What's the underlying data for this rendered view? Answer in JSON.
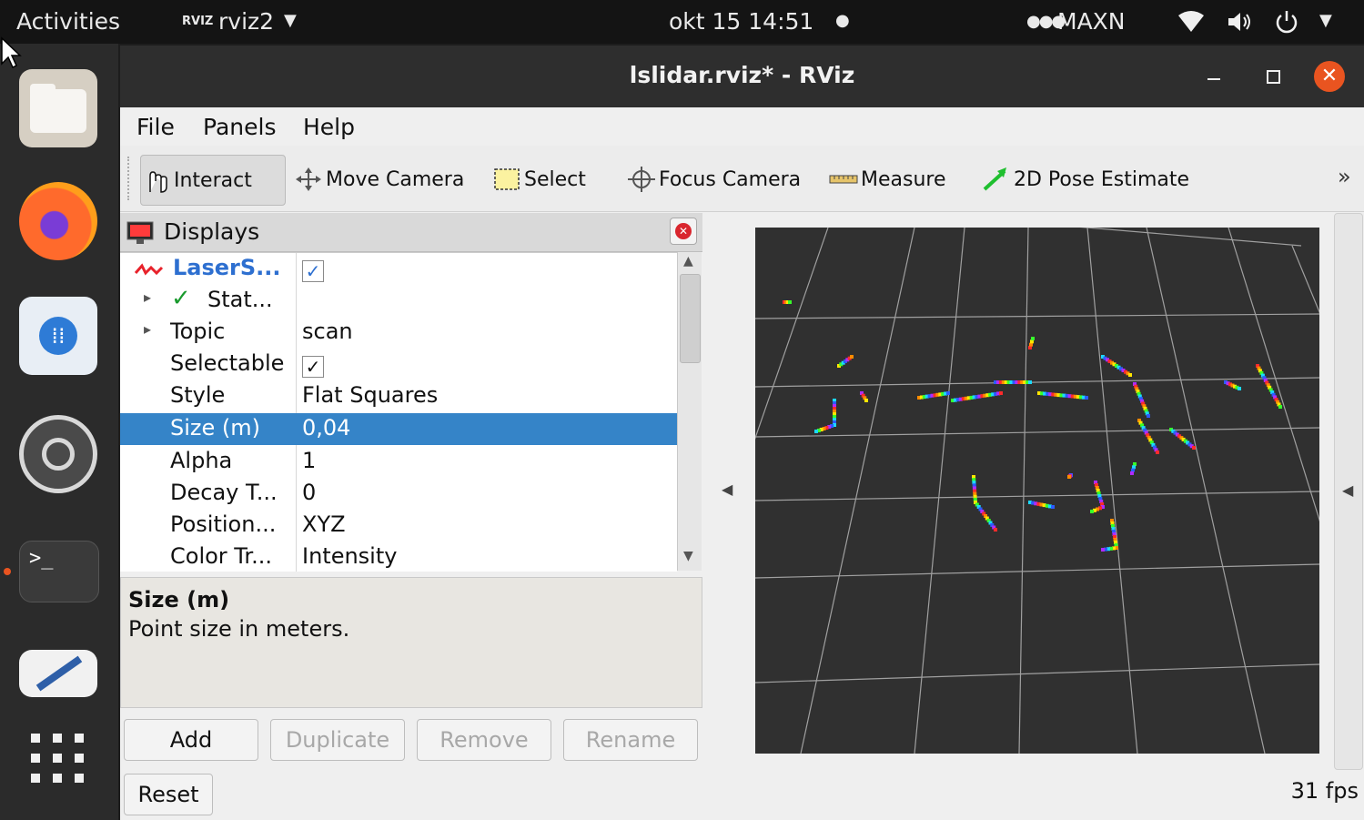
{
  "topbar": {
    "activities": "Activities",
    "app_badge": "RVIZ",
    "app_name": "rviz2",
    "datetime": "okt 15  14:51",
    "power_mode": "MAXN"
  },
  "dock": {
    "items": [
      "files-icon",
      "firefox-icon",
      "software-icon",
      "settings-icon",
      "terminal-icon",
      "text-editor-icon",
      "show-apps-icon"
    ]
  },
  "window": {
    "title": "lslidar.rviz* - RViz",
    "menu": {
      "file": "File",
      "panels": "Panels",
      "help": "Help"
    },
    "toolbar": {
      "interact": "Interact",
      "move_camera": "Move Camera",
      "select": "Select",
      "focus_camera": "Focus Camera",
      "measure": "Measure",
      "pose_estimate": "2D Pose Estimate",
      "overflow": "»"
    },
    "displays": {
      "title": "Displays",
      "rows": [
        {
          "key": "LaserS...",
          "value": ""
        },
        {
          "key": "Stat...",
          "value": ""
        },
        {
          "key": "Topic",
          "value": "scan"
        },
        {
          "key": "Selectable",
          "value": ""
        },
        {
          "key": "Style",
          "value": "Flat Squares"
        },
        {
          "key": "Size (m)",
          "value": "0,04"
        },
        {
          "key": "Alpha",
          "value": "1"
        },
        {
          "key": "Decay T...",
          "value": "0"
        },
        {
          "key": "Position...",
          "value": "XYZ"
        },
        {
          "key": "Color Tr...",
          "value": "Intensity"
        }
      ],
      "desc_title": "Size (m)",
      "desc_text": "Point size in meters.",
      "buttons": {
        "add": "Add",
        "duplicate": "Duplicate",
        "remove": "Remove",
        "rename": "Rename",
        "reset": "Reset"
      }
    },
    "fps": "31 fps"
  },
  "colors": {
    "selection": "#3584c8",
    "close_button": "#e95420",
    "render_background": "#303030",
    "grid_line": "#a0a0a0"
  }
}
